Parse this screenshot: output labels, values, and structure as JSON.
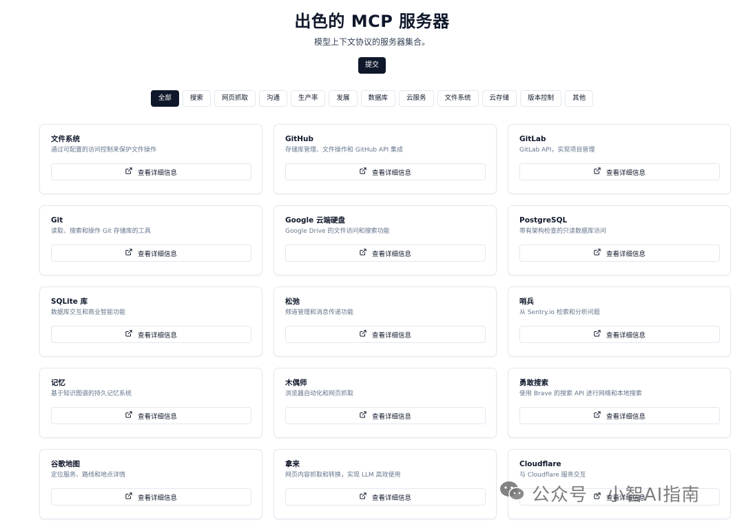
{
  "header": {
    "title": "出色的 MCP 服务器",
    "subtitle": "模型上下文协议的服务器集合。",
    "submit_label": "提交"
  },
  "filters": [
    "全部",
    "搜索",
    "网页抓取",
    "沟通",
    "生产率",
    "发展",
    "数据库",
    "云服务",
    "文件系统",
    "云存储",
    "版本控制",
    "其他"
  ],
  "active_filter": "全部",
  "detail_label": "查看详细信息",
  "detail_icon": "external-link-icon",
  "cards": [
    {
      "title": "文件系统",
      "desc": "通过可配置的访问控制来保护文件操作"
    },
    {
      "title": "GitHub",
      "desc": "存储库管理、文件操作和 GitHub API 集成"
    },
    {
      "title": "GitLab",
      "desc": "GitLab API，实现项目管理"
    },
    {
      "title": "Git",
      "desc": "读取、搜索和操作 Git 存储库的工具"
    },
    {
      "title": "Google 云端硬盘",
      "desc": "Google Drive 的文件访问和搜索功能"
    },
    {
      "title": "PostgreSQL",
      "desc": "带有架构检查的只读数据库访问"
    },
    {
      "title": "SQLite 库",
      "desc": "数据库交互和商业智能功能"
    },
    {
      "title": "松弛",
      "desc": "频道管理和消息传递功能"
    },
    {
      "title": "哨兵",
      "desc": "从 Sentry.io 检索和分析问题"
    },
    {
      "title": "记忆",
      "desc": "基于知识图谱的持久记忆系统"
    },
    {
      "title": "木偶师",
      "desc": "浏览器自动化和网页抓取"
    },
    {
      "title": "勇敢搜索",
      "desc": "使用 Brave 的搜索 API 进行网络和本地搜索"
    },
    {
      "title": "谷歌地图",
      "desc": "定位服务、路线和地点详情"
    },
    {
      "title": "拿来",
      "desc": "网页内容抓取和转换，实现 LLM 高效使用"
    },
    {
      "title": "Cloudflare",
      "desc": "与 Cloudflare 服务交互"
    }
  ],
  "watermark": {
    "text": "公众号 · 小智AI指南",
    "icon": "wechat-icon"
  }
}
